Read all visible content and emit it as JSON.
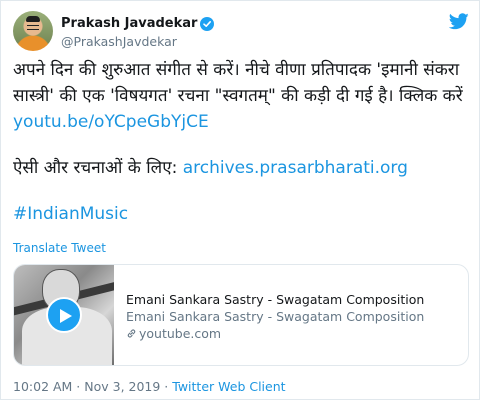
{
  "author": {
    "display_name": "Prakash Javadekar",
    "handle": "@PrakashJavdekar",
    "verified": true
  },
  "tweet": {
    "line1": "अपने दिन की शुरुआत संगीत से करें। नीचे वीणा प्रतिपादक 'इमानी संकरा सास्त्री' की एक 'विषयगत' रचना \"स्वगतम्\" की कड़ी दी गई है। क्लिक करें ",
    "link1": "youtu.be/oYCpeGbYjCE",
    "line2": "ऐसी और रचनाओं के लिए: ",
    "link2": "archives.prasarbharati.org",
    "hashtag": "#IndianMusic"
  },
  "translate_label": "Translate Tweet",
  "card": {
    "title": "Emani Sankara Sastry - Swagatam Composition",
    "description": "Emani Sankara Sastry - Swagatam Composition",
    "domain": "youtube.com"
  },
  "footer": {
    "timestamp": "10:02 AM · Nov 3, 2019 · ",
    "client": "Twitter Web Client"
  },
  "colors": {
    "accent": "#1da1f2",
    "link": "#1b95e0",
    "secondary_text": "#657786"
  },
  "icons": [
    "twitter-bird-icon",
    "verified-badge-icon",
    "play-icon",
    "link-icon"
  ]
}
